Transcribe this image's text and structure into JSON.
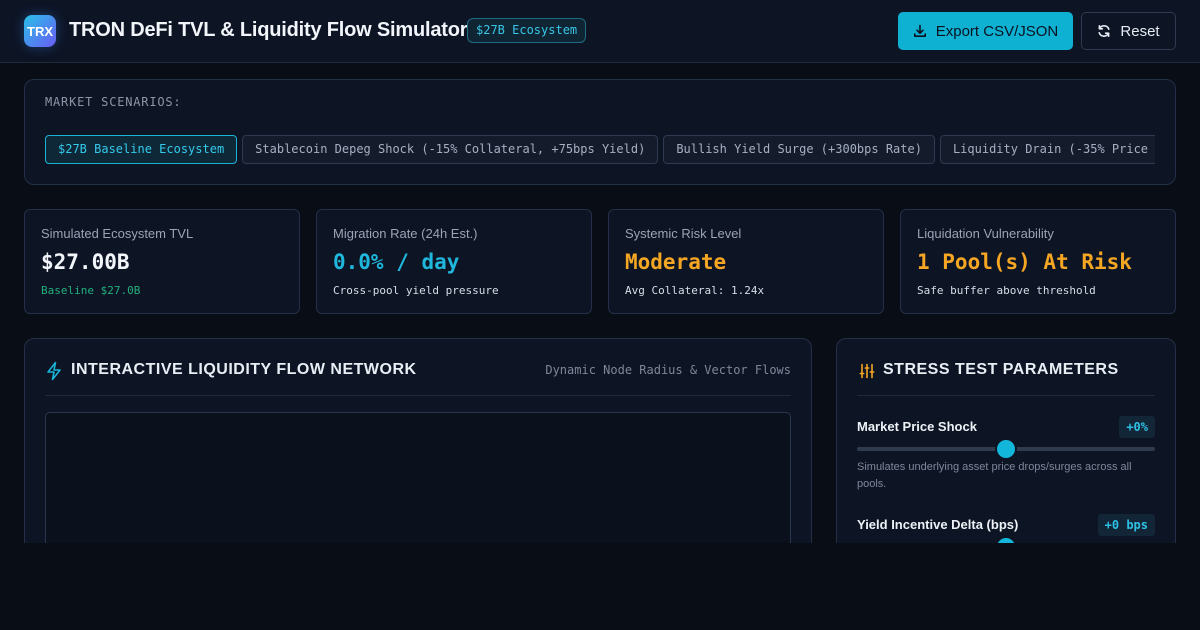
{
  "header": {
    "logo_text": "TRX",
    "title": "TRON DeFi TVL & Liquidity Flow Simulator",
    "badge": "$27B Ecosystem",
    "export_label": "Export CSV/JSON",
    "reset_label": "Reset"
  },
  "scenarios": {
    "label": "MARKET SCENARIOS:",
    "items": [
      {
        "label": "$27B Baseline Ecosystem"
      },
      {
        "label": "Stablecoin Depeg Shock (-15% Collateral, +75bps Yield)"
      },
      {
        "label": "Bullish Yield Surge (+300bps Rate)"
      },
      {
        "label": "Liquidity Drain (-35% Price"
      }
    ],
    "active_index": 0
  },
  "metrics": [
    {
      "label": "Simulated Ecosystem TVL",
      "value": "$27.00B",
      "sub": "Baseline $27.0B",
      "value_color": "#f2f5fa",
      "sub_color": "#22b07d"
    },
    {
      "label": "Migration Rate (24h Est.)",
      "value": "0.0% / day",
      "sub": "Cross-pool yield pressure",
      "value_color": "#1fb7db",
      "sub_color": "#d7dde7"
    },
    {
      "label": "Systemic Risk Level",
      "value": "Moderate",
      "sub": "Avg Collateral: 1.24x",
      "value_color": "#f5a623",
      "sub_color": "#d7dde7"
    },
    {
      "label": "Liquidation Vulnerability",
      "value": "1 Pool(s) At Risk",
      "sub": "Safe buffer above threshold",
      "value_color": "#f5a623",
      "sub_color": "#d7dde7"
    }
  ],
  "network": {
    "title": "INTERACTIVE LIQUIDITY FLOW NETWORK",
    "hint": "Dynamic Node Radius & Vector Flows"
  },
  "stress": {
    "title": "STRESS TEST PARAMETERS",
    "params": [
      {
        "label": "Market Price Shock",
        "value": "+0%",
        "level": 0.5,
        "desc": "Simulates underlying asset price drops/surges across all pools."
      },
      {
        "label": "Yield Incentive Delta (bps)",
        "value": "+0 bps",
        "level": 0.5,
        "desc": ""
      }
    ]
  },
  "colors": {
    "accent": "#12b6da",
    "warning": "#f5a623",
    "success": "#22b07d",
    "background": "#090d16",
    "panel": "#0d1424"
  }
}
